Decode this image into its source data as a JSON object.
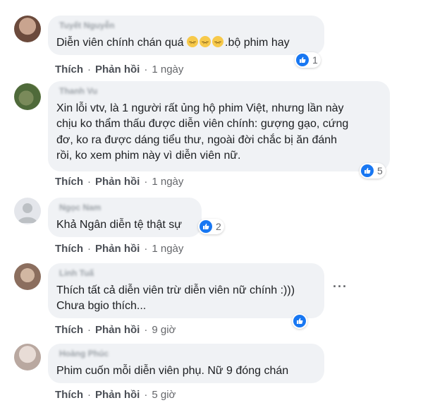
{
  "colors": {
    "bubble": "#f0f2f5",
    "like_blue": "#1877f2",
    "meta_gray": "#65676b"
  },
  "labels": {
    "like": "Thích",
    "reply": "Phản hồi",
    "sep": "·"
  },
  "icons": {
    "reaction": "like-thumb-icon",
    "emoji": "disappointed-face-icon",
    "menu": "more-options-icon"
  },
  "comments": [
    {
      "author": "Tuyết Nguyễn",
      "lines": [
        "Diễn viên chính chán quá ",
        ".bộ phim hay"
      ],
      "emoji_count": 3,
      "time": "1 ngày",
      "reactions": "1"
    },
    {
      "author": "Thanh Vu",
      "lines": [
        "Xin lỗi vtv, là 1 người rất ủng hộ phim Việt, nhưng lần này",
        "chịu ko thẩm thấu được diễn viên chính: gượng gạo, cứng",
        "đơ, ko ra được dáng tiểu thư, ngoài đời chắc bị ăn đánh",
        "rồi, ko xem phim này vì diễn viên nữ."
      ],
      "time": "1 ngày",
      "reactions": "5"
    },
    {
      "author": "Ngọc Nam",
      "lines": [
        "Khả Ngân diễn tệ thật sự"
      ],
      "time": "1 ngày",
      "reactions": "2"
    },
    {
      "author": "Linh Tuấ",
      "lines": [
        "Thích tất cả diễn viên trừ diễn viên nữ chính :)))",
        "Chưa bgio thích..."
      ],
      "time": "9 giờ",
      "reactions": ""
    },
    {
      "author": "Hoàng Phúc",
      "lines": [
        "Phim cuốn mỗi diễn viên phụ. Nữ 9 đóng chán"
      ],
      "time": "5 giờ",
      "reactions": ""
    }
  ],
  "menu_dots": "···"
}
